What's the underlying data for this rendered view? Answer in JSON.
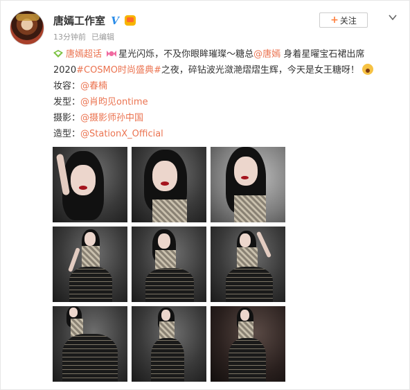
{
  "post": {
    "user_name": "唐嫣工作室",
    "time": "13分钟前",
    "edited": "已编辑",
    "follow_label": "关注",
    "follow_plus": "+",
    "verified_glyph": "V"
  },
  "content": {
    "super_topic": "唐嫣超话",
    "text1": "星光闪烁，不及你眼眸璀璨～糖总",
    "mention_main": "@唐嫣",
    "text2": " 身着星曜宝石裙出席",
    "text3": "2020",
    "topic": "#COSMO时尚盛典#",
    "text4": "之夜，碎钻波光潋滟熠熠生辉，今天是女王糖呀！",
    "credits": [
      {
        "label": "妆容：",
        "handle": "@春楠"
      },
      {
        "label": "发型：",
        "handle": "@肖昀见ontime"
      },
      {
        "label": "摄影：",
        "handle": "@摄影师孙中国"
      },
      {
        "label": "造型：",
        "handle": "@StationX_Official"
      }
    ]
  },
  "colors": {
    "link": "#eb7350",
    "follow_plus": "#ff8140",
    "verified": "#2a8ce8"
  },
  "icons": [
    "avatar",
    "verified-icon",
    "vip-icon",
    "chevron-down-icon",
    "super-topic-icon",
    "candy-icon",
    "shocked-emoji-icon"
  ]
}
